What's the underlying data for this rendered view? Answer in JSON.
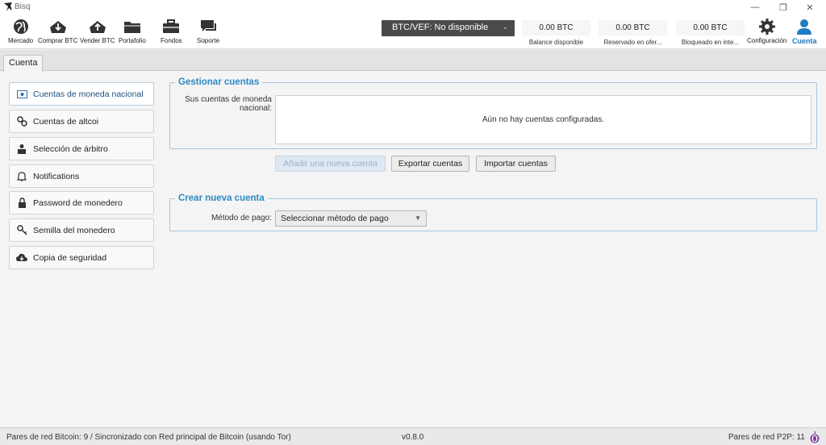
{
  "window": {
    "title": "Bisq",
    "controls": {
      "minimize": "—",
      "restore": "❐",
      "close": "✕"
    }
  },
  "nav": {
    "items": [
      {
        "label": "Mercado",
        "icon": "globe-icon"
      },
      {
        "label": "Comprar BTC",
        "icon": "buy-btc-icon"
      },
      {
        "label": "Vender BTC",
        "icon": "sell-btc-icon"
      },
      {
        "label": "Portafolio",
        "icon": "folder-icon"
      },
      {
        "label": "Fondos",
        "icon": "briefcase-icon"
      },
      {
        "label": "Soporte",
        "icon": "chat-icon"
      }
    ],
    "settings": {
      "label": "Configuración",
      "icon": "gear-icon"
    },
    "account": {
      "label": "Cuenta",
      "icon": "user-icon"
    }
  },
  "market_price": {
    "label": "BTC/VEF: No disponible"
  },
  "balances": [
    {
      "value": "0.00 BTC",
      "label": "Balance disponible"
    },
    {
      "value": "0.00 BTC",
      "label": "Reservado en ofer..."
    },
    {
      "value": "0.00 BTC",
      "label": "Bloqueado en inte..."
    }
  ],
  "tabs": [
    {
      "label": "Cuenta"
    }
  ],
  "sidebar": {
    "items": [
      {
        "label": "Cuentas de moneda nacional",
        "icon": "banknote-icon"
      },
      {
        "label": "Cuentas de altcoi",
        "icon": "link-icon"
      },
      {
        "label": "Selección de árbitro",
        "icon": "arbitrator-icon"
      },
      {
        "label": "Notifications",
        "icon": "bell-icon"
      },
      {
        "label": "Password de monedero",
        "icon": "lock-icon"
      },
      {
        "label": "Semilla del monedero",
        "icon": "key-icon"
      },
      {
        "label": "Copia de seguridad",
        "icon": "cloud-download-icon"
      }
    ]
  },
  "manage": {
    "title": "Gestionar cuentas",
    "accounts_label": "Sus cuentas de moneda nacional:",
    "empty_text": "Aún no hay cuentas configuradas.",
    "add_button": "Añadir una nueva cuenta",
    "export_button": "Exportar cuentas",
    "import_button": "Importar cuentas"
  },
  "create": {
    "title": "Crear nueva cuenta",
    "payment_label": "Método de pago:",
    "payment_selected": "Seleccionar método de pago"
  },
  "status": {
    "left": "Pares de red Bitcoin: 9 / Sincronizado con Red principal de Bitcoin (usando Tor)",
    "version": "v0.8.0",
    "p2p": "Pares de red P2P: 11"
  },
  "colors": {
    "accent": "#2b8ac4",
    "active_nav": "#1e7bc1",
    "dark_select": "#4a4a4a"
  }
}
